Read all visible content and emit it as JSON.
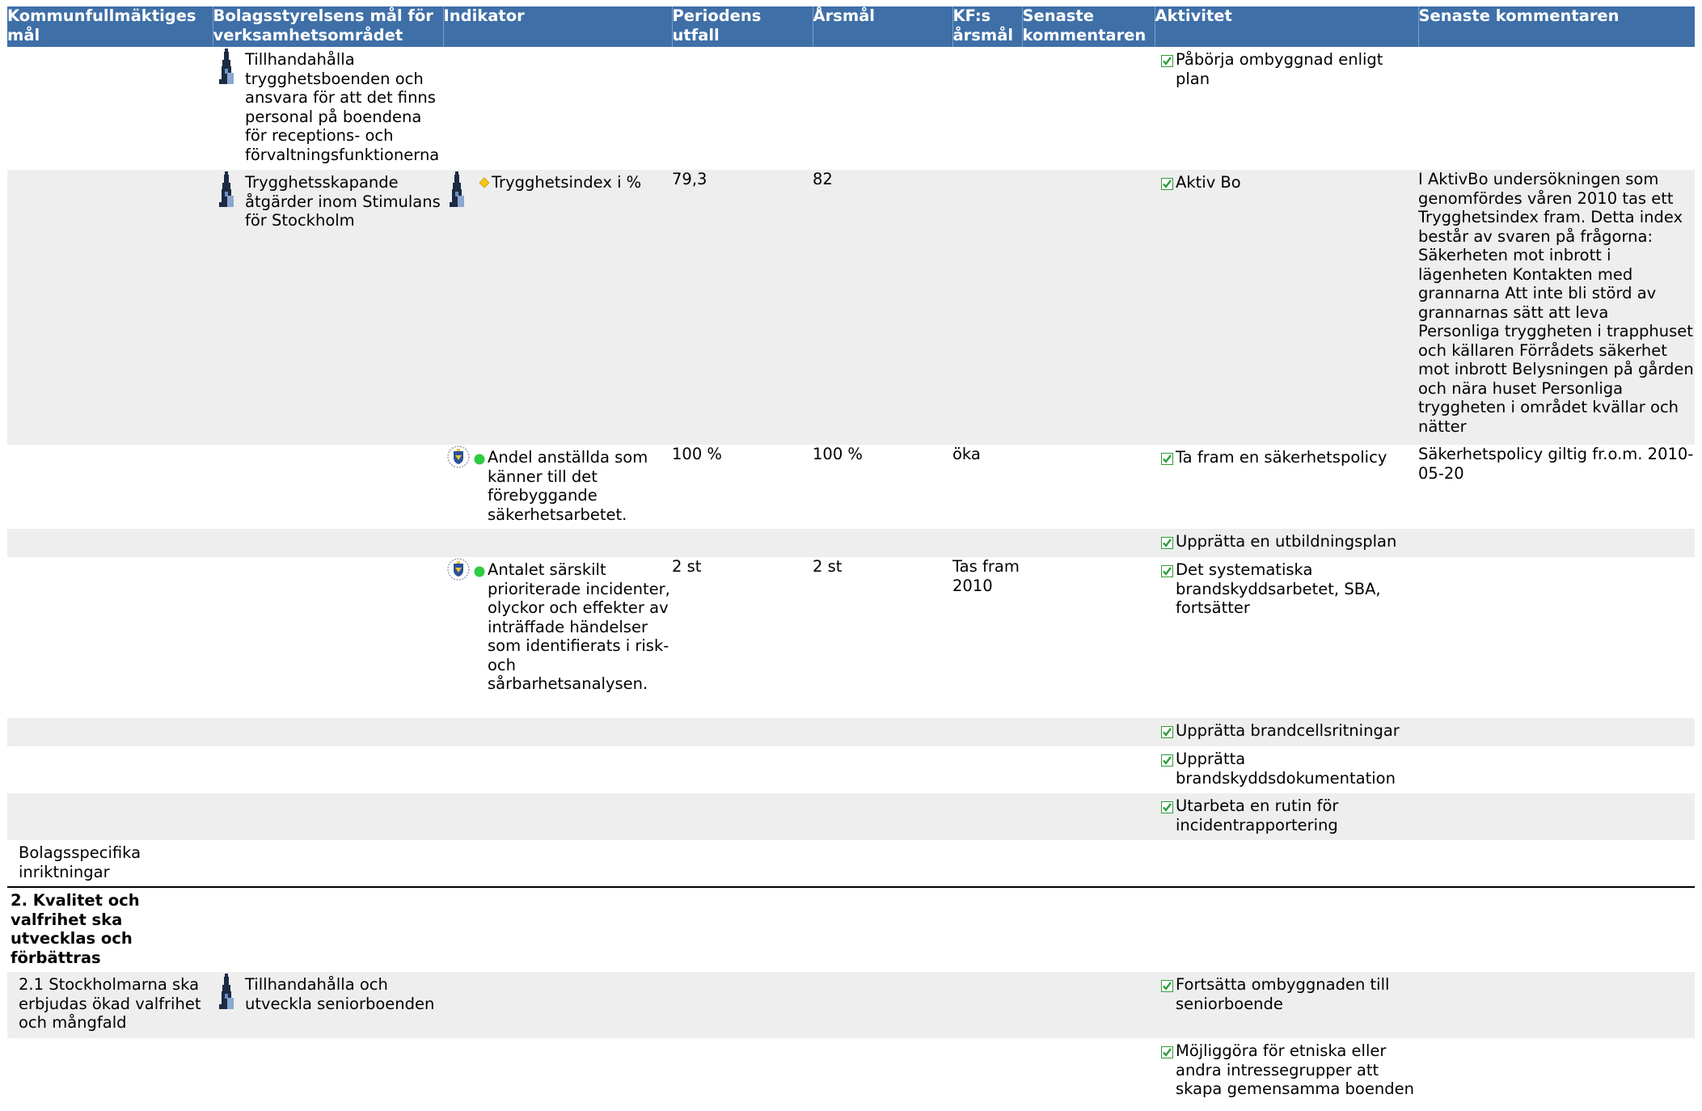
{
  "headers": {
    "kf_goal": "Kommunfullmäktiges mål",
    "board_goal": "Bolagsstyrelsens mål för verksamhetsområdet",
    "indicator": "Indikator",
    "period_outcome": "Periodens utfall",
    "annual_target": "Årsmål",
    "kf_annual_target": "KF:s årsmål",
    "latest_comments_1": "Senaste kommentaren",
    "activity": "Aktivitet",
    "latest_comment_2": "Senaste kommentaren"
  },
  "rows": [
    {
      "board_goal": "Tillhandahålla trygghetsboenden och ansvara för att det finns personal på boendena för receptions- och förvaltningsfunktionerna",
      "activity": "Påbörja ombyggnad enligt plan"
    },
    {
      "board_goal": "Trygghetsskapande åtgärder inom Stimulans för Stockholm",
      "indicator": "Trygghetsindex i %",
      "indicator_status": "diamond-yellow",
      "outcome": "79,3",
      "target": "82",
      "activity": "Aktiv Bo",
      "comment": "I AktivBo undersökningen som genomfördes våren 2010 tas ett Trygghetsindex fram. Detta index består av svaren på frågorna: Säkerheten mot inbrott i lägenheten Kontakten med grannarna Att inte bli störd av grannarnas sätt att leva Personliga tryggheten i trapphuset och källaren Förrådets säkerhet mot inbrott Belysningen på gården och nära huset Personliga tryggheten i området kvällar och nätter"
    },
    {
      "indicator": "Andel anställda som känner till det förebyggande säkerhetsarbetet.",
      "indicator_status": "circle-green",
      "outcome": "100 %",
      "target": "100 %",
      "kf_target": "öka",
      "activity": "Ta fram en säkerhetspolicy",
      "comment": "Säkerhetspolicy giltig fr.o.m. 2010-05-20"
    },
    {
      "activity": "Upprätta en utbildningsplan"
    },
    {
      "indicator": "Antalet särskilt prioriterade incidenter, olyckor och effekter av inträffade händelser som identifierats i risk- och sårbarhetsanalysen.",
      "indicator_status": "circle-green",
      "outcome": "2 st",
      "target": "2 st",
      "kf_target": "Tas fram 2010",
      "activity": "Det systematiska brandskyddsarbetet, SBA, fortsätter"
    },
    {
      "activity": "Upprätta brandcellsritningar"
    },
    {
      "activity": "Upprätta brandskyddsdokumentation"
    },
    {
      "activity": "Utarbeta en rutin för incidentrapportering"
    },
    {
      "kf_goal": "Bolagsspecifika inriktningar"
    },
    {
      "kf_goal": "2. Kvalitet och valfrihet ska utvecklas och förbättras"
    },
    {
      "kf_goal": "2.1 Stockholmarna ska erbjudas ökad valfrihet och mångfald",
      "board_goal": "Tillhandahålla och utveckla seniorboenden",
      "activity": "Fortsätta ombyggnaden till seniorboende"
    },
    {
      "activity": "Möjliggöra för etniska eller andra intressegrupper att skapa gemensamma boenden"
    }
  ],
  "colors": {
    "header_bg": "#3e6fa7",
    "stripe": "#eeeeee",
    "status_green": "#2ecc40",
    "status_yellow": "#f5c518",
    "check_green": "#2e9c3c"
  },
  "icons": {
    "goal_owner": "stockholm-tower-icon",
    "indicator_owner": "city-seal-icon",
    "activity": "checkbox-checked-icon"
  }
}
